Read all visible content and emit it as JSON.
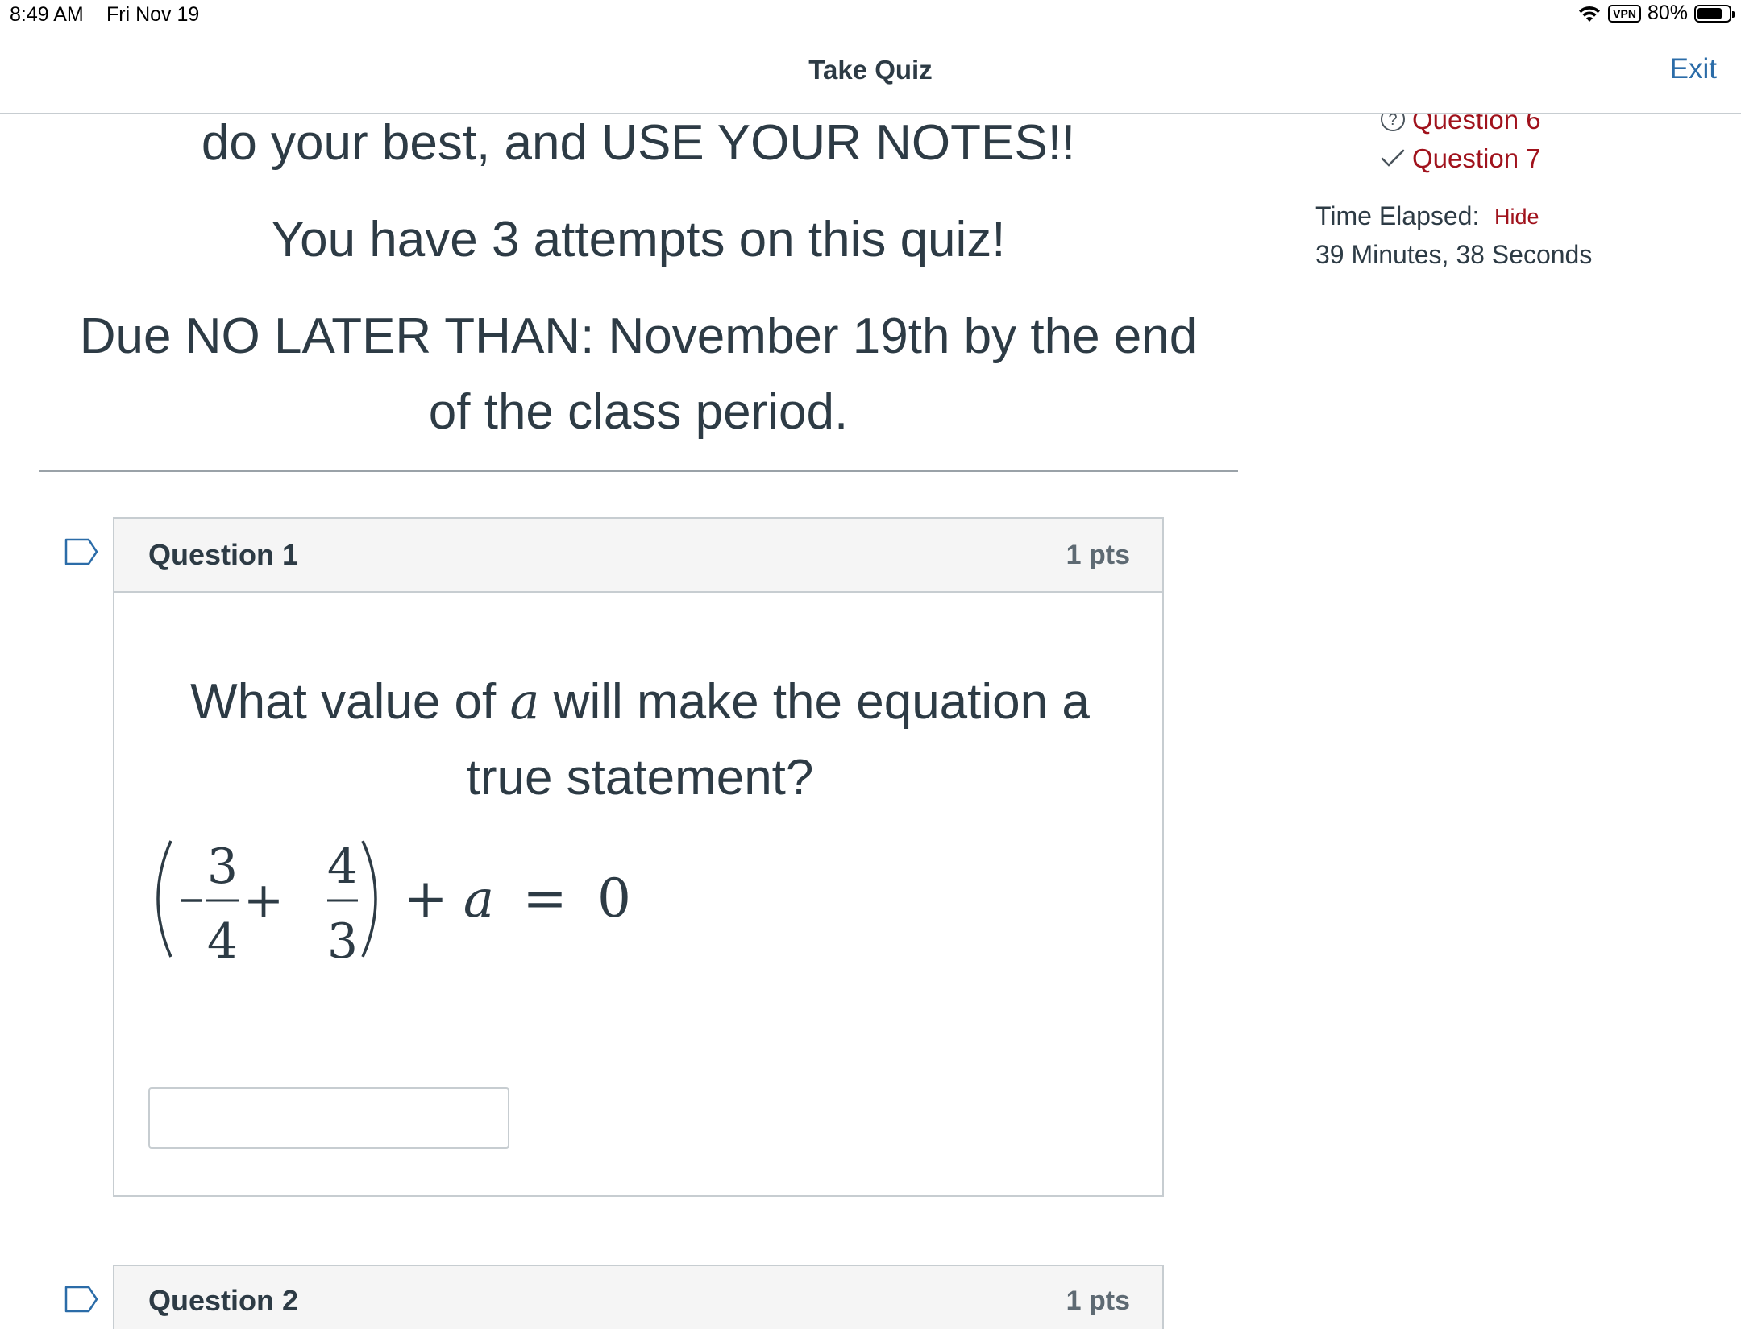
{
  "status_bar": {
    "time": "8:49 AM",
    "date": "Fri Nov 19",
    "vpn": "VPN",
    "battery": "80%",
    "battery_level": 0.8
  },
  "nav": {
    "title": "Take Quiz",
    "exit_label": "Exit"
  },
  "intro": {
    "line1": "do your best, and USE YOUR NOTES!!",
    "line2": "You have 3 attempts on this quiz!",
    "line3a": "Due NO LATER THAN: November 19th by the end",
    "line3b": "of the class period."
  },
  "question1": {
    "name": "Question 1",
    "points": "1 pts",
    "text_part1": "What value of ",
    "variable": "a",
    "text_part2": " will make the equation a",
    "text_line2": "true statement?",
    "equation": {
      "frac1_num": "3",
      "frac1_den": "4",
      "frac2_num": "4",
      "frac2_den": "3",
      "variable": "a",
      "rhs": "0"
    },
    "answer_value": ""
  },
  "question2": {
    "name": "Question 2",
    "points": "1 pts"
  },
  "sidebar": {
    "questions": [
      {
        "label": "Question 6",
        "status_icon": "question-circle-icon"
      },
      {
        "label": "Question 7",
        "status_icon": "checkmark-icon"
      }
    ],
    "time_elapsed_label": "Time Elapsed:",
    "hide_label": "Hide",
    "time_elapsed_value": "39 Minutes, 38 Seconds"
  },
  "colors": {
    "text": "#2d3b45",
    "link_blue": "#2b6ca8",
    "link_red": "#a0121c",
    "border": "#c7cdd1",
    "header_bg": "#f5f5f5"
  }
}
